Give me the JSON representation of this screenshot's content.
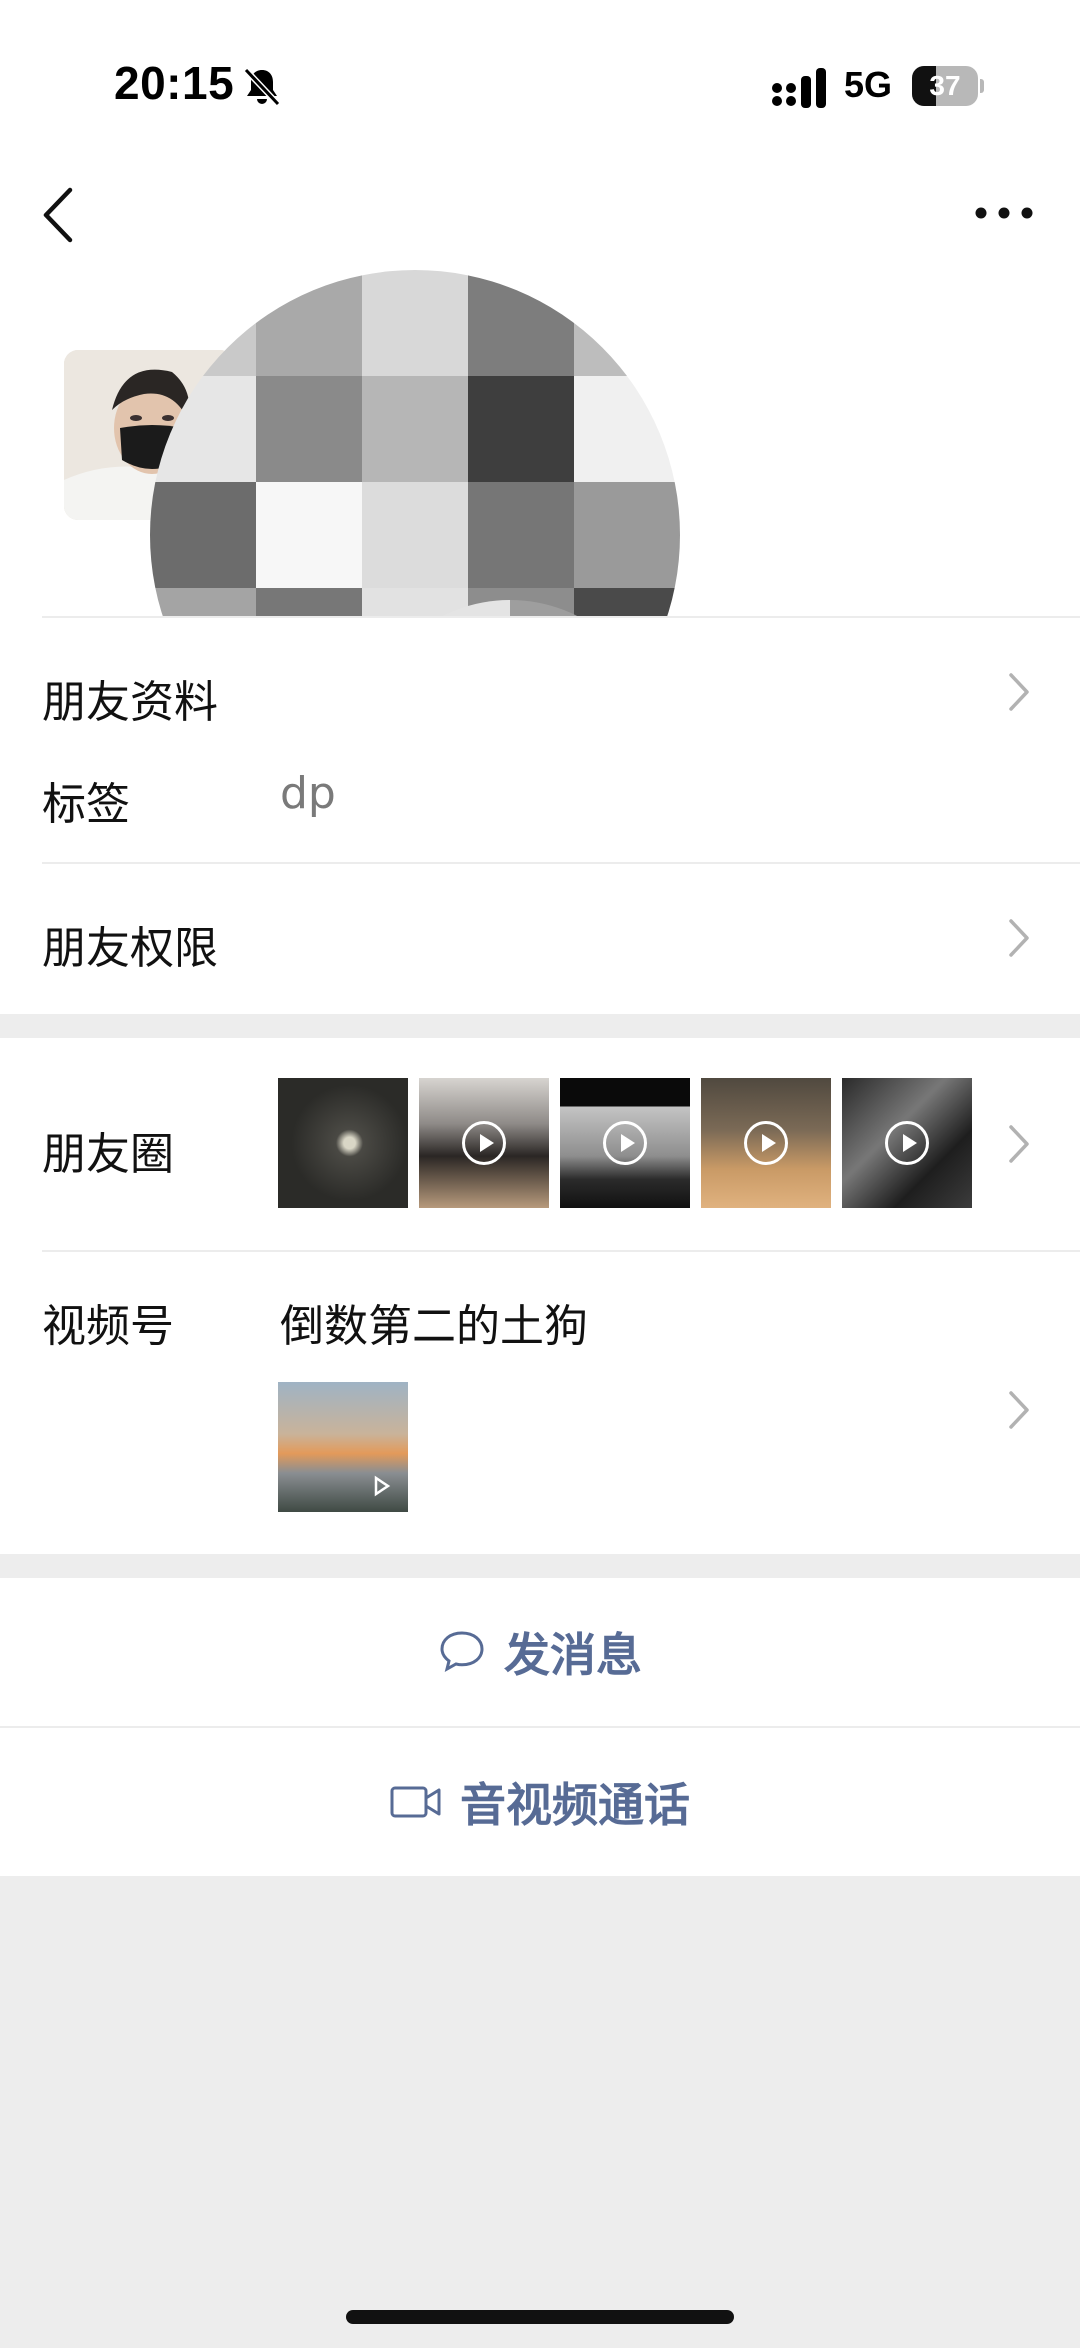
{
  "status_bar": {
    "time": "20:15",
    "network": "5G",
    "battery_percent": "37",
    "battery_level": 0.37,
    "icons": [
      "bell-off-icon",
      "signal-icon",
      "battery-icon"
    ]
  },
  "header": {
    "icons": [
      "back-arrow-icon",
      "more-icon"
    ]
  },
  "rows": {
    "friend_info": {
      "label": "朋友资料"
    },
    "tags": {
      "label": "标签",
      "value": "dp"
    },
    "friend_permissions": {
      "label": "朋友权限"
    },
    "moments": {
      "label": "朋友圈"
    },
    "channels": {
      "label": "视频号",
      "name": "倒数第二的土狗"
    }
  },
  "actions": {
    "send_message": "发消息",
    "video_call": "音视频通话"
  },
  "colors": {
    "link_blue": "#576b95",
    "background": "#ededed"
  }
}
